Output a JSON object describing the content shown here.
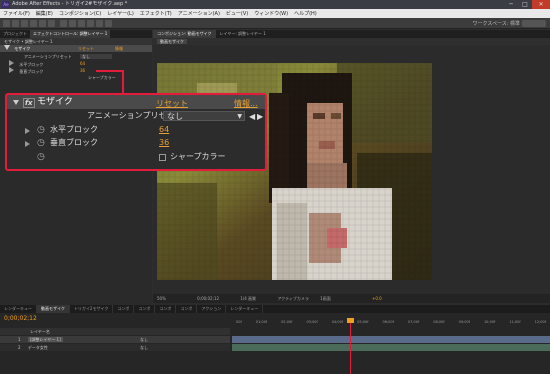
{
  "titlebar": {
    "logo": "Ae",
    "title": "Adobe After Effects - トリガイ2#モザイク.aep *",
    "btn_min": "─",
    "btn_max": "□",
    "btn_close": "✕"
  },
  "menu": [
    "ファイル(F)",
    "編集(E)",
    "コンポジション(C)",
    "レイヤー(L)",
    "エフェクト(T)",
    "アニメーション(A)",
    "ビュー(V)",
    "ウィンドウ(W)",
    "ヘルプ(H)"
  ],
  "toolbar": {
    "workspace": "ワークスペース: 標準"
  },
  "left_panel": {
    "tabs": [
      "プロジェクト",
      "エフェクトコントロール: 調整レイヤー 1"
    ],
    "subhead": "モザイク • 調整レイヤー 1",
    "fx_name": "モザイク",
    "fx_reset": "リセット",
    "fx_info": "情報",
    "preset_label": "アニメーションプリセット",
    "preset_value": "なし",
    "h_label": "水平ブロック",
    "h_value": "64",
    "v_label": "垂直ブロック",
    "v_value": "36",
    "sharp_label": "シャープカラー"
  },
  "callout": {
    "fx_icon": "fx",
    "fx_name": "モザイク",
    "reset": "リセット",
    "info": "情報...",
    "preset_label": "アニメーションプリセット：",
    "preset_value": "なし",
    "h_label": "水平ブロック",
    "h_value": "64",
    "v_label": "垂直ブロック",
    "v_value": "36",
    "sharp_label": "シャープカラー"
  },
  "right_panel": {
    "tabs": [
      "コンポジション: 動画モザイク",
      "レイヤー: 調整レイヤー 1"
    ],
    "comp_tab": "動画モザイク"
  },
  "viewer_bar": {
    "zoom": "50%",
    "timecode": "0;00;02;12",
    "res": "1/4 画質",
    "view": "アクティブカメラ",
    "views": "1画面",
    "exposure": "+0.0"
  },
  "timeline": {
    "tabs": [
      "レンダーキュー",
      "動画モザイク",
      "トリガイ2モザイク",
      "コンポ",
      "コンポ",
      "コンポ",
      "コンポ",
      "アクション",
      "レンダーキュー"
    ],
    "timecode": "0;00;02;12",
    "layer_col": "レイヤー名",
    "layers": [
      {
        "num": "1",
        "name": "[調整レイヤー 1]",
        "parent": "なし"
      },
      {
        "num": "2",
        "name": "データ女性",
        "parent": "なし"
      }
    ],
    "ruler": [
      "00f",
      "01;00f",
      "02;00f",
      "03;00f",
      "04;00f",
      "05;00f",
      "06;00f",
      "07;00f",
      "08;00f",
      "09;00f",
      "10;00f",
      "11;00f",
      "12;00f"
    ]
  },
  "colors": {
    "accent": "#e21c3a",
    "orange": "#f0a020",
    "playhead": "#f0a020"
  }
}
